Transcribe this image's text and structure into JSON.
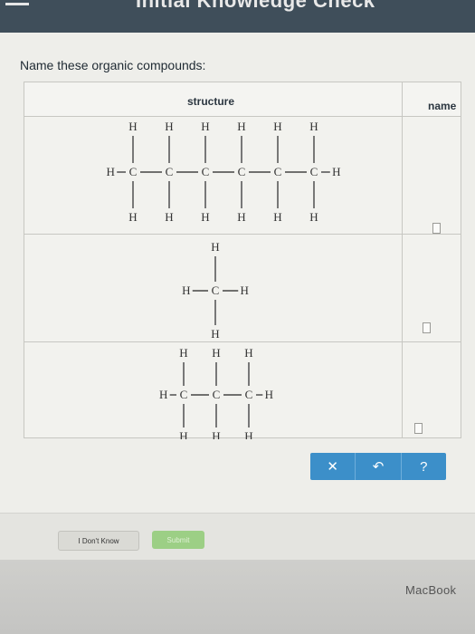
{
  "header": {
    "title": "Initial Knowledge Check"
  },
  "prompt": "Name these organic compounds:",
  "table": {
    "headers": {
      "structure": "structure",
      "name": "name"
    },
    "rows": [
      {
        "compound": "hexane structure",
        "answer": ""
      },
      {
        "compound": "methane structure",
        "answer": ""
      },
      {
        "compound": "propane structure",
        "answer": ""
      }
    ]
  },
  "atoms": {
    "H": "H",
    "C": "C"
  },
  "toolbar": {
    "clear_glyph": "✕",
    "undo_glyph": "↶",
    "help_glyph": "?"
  },
  "footer": {
    "dont_know": "I Don't Know",
    "submit": "Submit"
  },
  "device": {
    "brand": "MacBook"
  },
  "colors": {
    "accent": "#3c8fc9",
    "submit_green": "#9ccf85"
  }
}
